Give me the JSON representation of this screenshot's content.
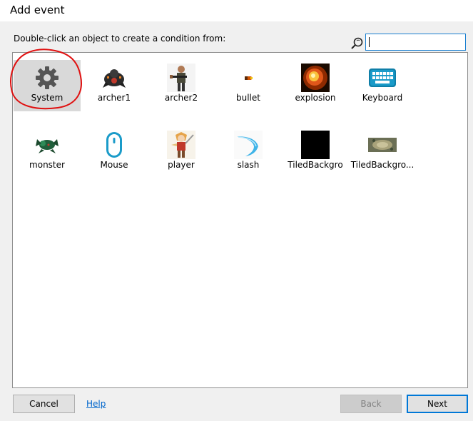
{
  "window": {
    "title": "Add event"
  },
  "instruction": "Double-click an object to create a condition from:",
  "search": {
    "value": "",
    "placeholder": ""
  },
  "objects": [
    {
      "label": "System",
      "icon": "gear-icon",
      "selected": true
    },
    {
      "label": "archer1",
      "icon": "archer-sprite-icon"
    },
    {
      "label": "archer2",
      "icon": "soldier-sprite-icon"
    },
    {
      "label": "bullet",
      "icon": "bullet-sprite-icon"
    },
    {
      "label": "explosion",
      "icon": "explosion-sprite-icon"
    },
    {
      "label": "Keyboard",
      "icon": "keyboard-icon"
    },
    {
      "label": "monster",
      "icon": "monster-sprite-icon"
    },
    {
      "label": "Mouse",
      "icon": "mouse-icon"
    },
    {
      "label": "player",
      "icon": "player-sprite-icon"
    },
    {
      "label": "slash",
      "icon": "slash-sprite-icon"
    },
    {
      "label": "TiledBackgro",
      "icon": "tiled-background-black-icon"
    },
    {
      "label": "TiledBackgro...",
      "icon": "tiled-background-texture-icon"
    }
  ],
  "buttons": {
    "cancel": "Cancel",
    "help": "Help",
    "back": "Back",
    "next": "Next"
  },
  "colors": {
    "accent": "#0078d7",
    "link": "#0066cc",
    "annotation": "#e01010",
    "selected_bg": "#d9d9d9"
  }
}
